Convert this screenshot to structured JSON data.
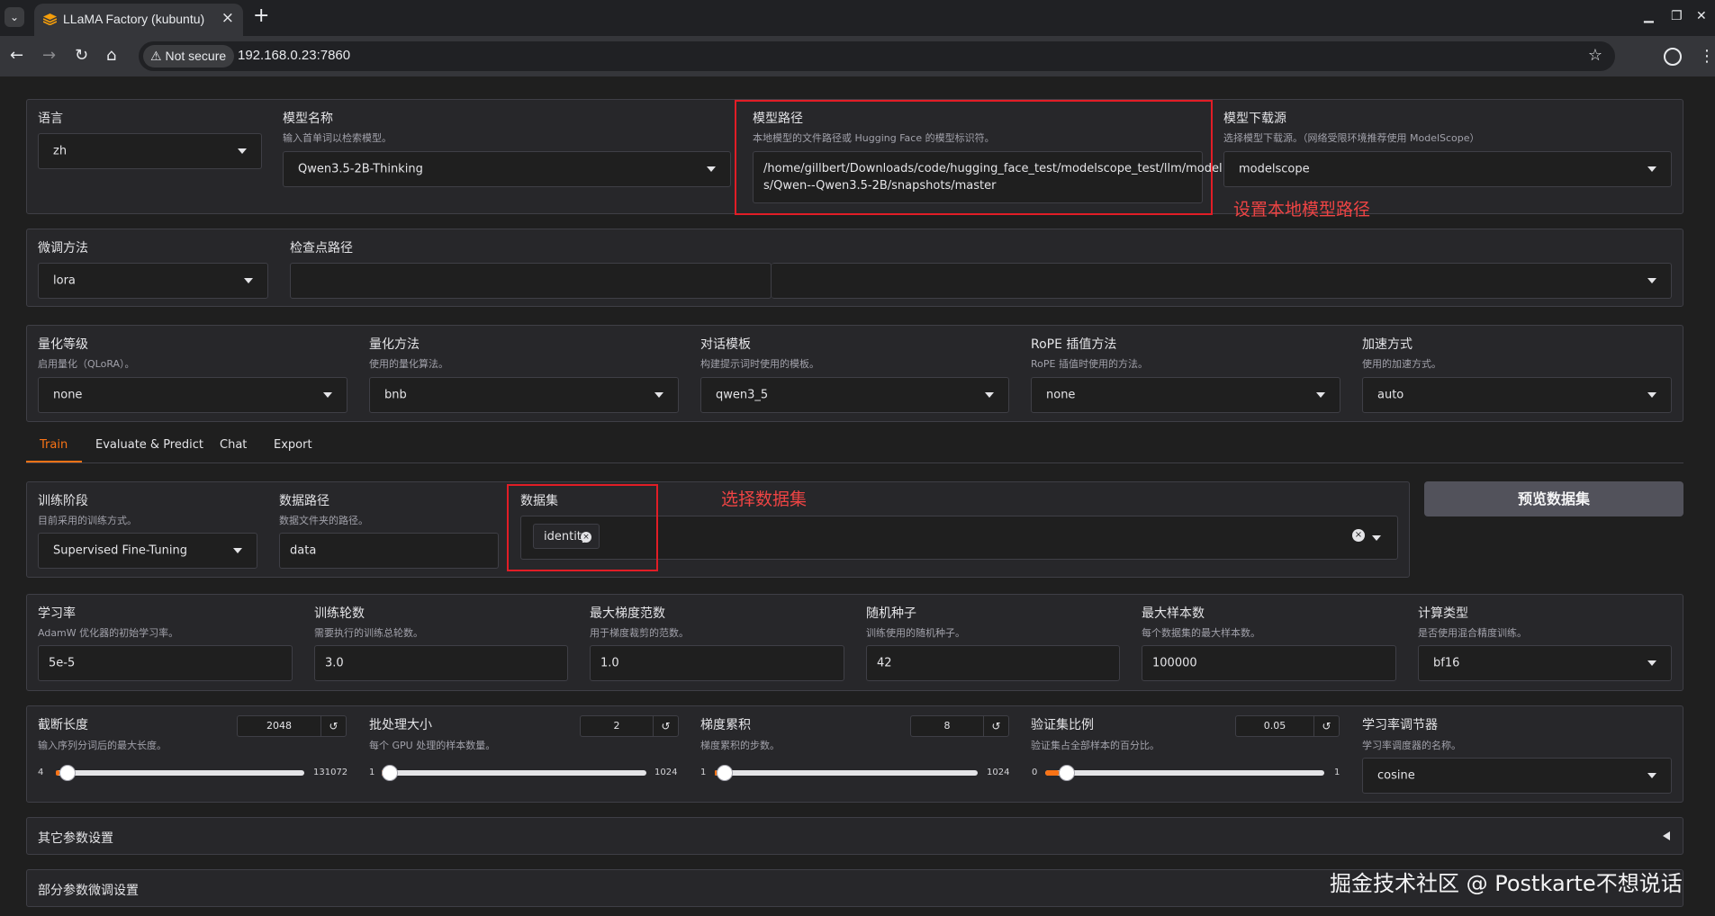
{
  "browser": {
    "tab_title": "LLaMA Factory (kubuntu)",
    "not_secure": "Not secure",
    "url": "192.168.0.23:7860"
  },
  "top": {
    "lang": {
      "label": "语言",
      "value": "zh"
    },
    "model_name": {
      "label": "模型名称",
      "info": "输入首单词以检索模型。",
      "value": "Qwen3.5-2B-Thinking"
    },
    "model_path": {
      "label": "模型路径",
      "info": "本地模型的文件路径或 Hugging Face 的模型标识符。",
      "value_line1": "/home/gillbert/Downloads/code/hugging_face_test/modelscope_test/llm/model",
      "value_line2": "s/Qwen--Qwen3.5-2B/snapshots/master"
    },
    "hub": {
      "label": "模型下载源",
      "info": "选择模型下载源。（网络受限环境推荐使用 ModelScope）",
      "value": "modelscope"
    }
  },
  "annotations": {
    "model_path": "设置本地模型路径",
    "dataset": "选择数据集"
  },
  "finetune": {
    "method": {
      "label": "微调方法",
      "value": "lora"
    },
    "checkpoint": {
      "label": "检查点路径",
      "value": ""
    }
  },
  "quant": {
    "bit": {
      "label": "量化等级",
      "info": "启用量化（QLoRA）。",
      "value": "none"
    },
    "method": {
      "label": "量化方法",
      "info": "使用的量化算法。",
      "value": "bnb"
    },
    "template": {
      "label": "对话模板",
      "info": "构建提示词时使用的模板。",
      "value": "qwen3_5"
    },
    "rope": {
      "label": "RoPE 插值方法",
      "info": "RoPE 插值时使用的方法。",
      "value": "none"
    },
    "booster": {
      "label": "加速方式",
      "info": "使用的加速方式。",
      "value": "auto"
    }
  },
  "tabs": [
    "Train",
    "Evaluate & Predict",
    "Chat",
    "Export"
  ],
  "train": {
    "stage": {
      "label": "训练阶段",
      "info": "目前采用的训练方式。",
      "value": "Supervised Fine-Tuning"
    },
    "dataset_dir": {
      "label": "数据路径",
      "info": "数据文件夹的路径。",
      "value": "data"
    },
    "dataset": {
      "label": "数据集",
      "chip": "identity"
    },
    "preview_button": "预览数据集",
    "lr": {
      "label": "学习率",
      "info": "AdamW 优化器的初始学习率。",
      "value": "5e-5"
    },
    "epochs": {
      "label": "训练轮数",
      "info": "需要执行的训练总轮数。",
      "value": "3.0"
    },
    "max_grad_norm": {
      "label": "最大梯度范数",
      "info": "用于梯度裁剪的范数。",
      "value": "1.0"
    },
    "seed": {
      "label": "随机种子",
      "info": "训练使用的随机种子。",
      "value": "42"
    },
    "max_samples": {
      "label": "最大样本数",
      "info": "每个数据集的最大样本数。",
      "value": "100000"
    },
    "compute_type": {
      "label": "计算类型",
      "info": "是否使用混合精度训练。",
      "value": "bf16"
    },
    "cutoff_len": {
      "label": "截断长度",
      "info": "输入序列分词后的最大长度。",
      "value": "2048",
      "min": "4",
      "max": "131072",
      "level": 0.0156
    },
    "batch_size": {
      "label": "批处理大小",
      "info": "每个 GPU 处理的样本数量。",
      "value": "2",
      "min": "1",
      "max": "1024",
      "level": 0.001
    },
    "grad_accum": {
      "label": "梯度累积",
      "info": "梯度累积的步数。",
      "value": "8",
      "min": "1",
      "max": "1024",
      "level": 0.0068
    },
    "val_size": {
      "label": "验证集比例",
      "info": "验证集占全部样本的百分比。",
      "value": "0.05",
      "min": "0",
      "max": "1",
      "level": 0.05
    },
    "lr_scheduler": {
      "label": "学习率调节器",
      "info": "学习率调度器的名称。",
      "value": "cosine"
    },
    "extra_args": "其它参数设置",
    "freeze_args": "部分参数微调设置"
  },
  "watermark": "掘金技术社区 @ Postkarte不想说话"
}
